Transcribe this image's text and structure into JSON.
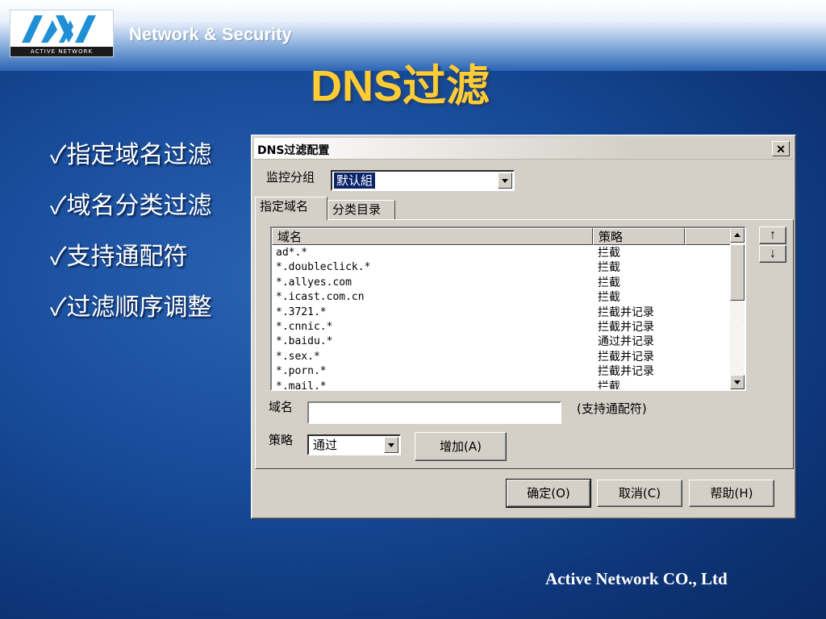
{
  "brand": {
    "logo_text": "ACTIVE NETWORK",
    "tagline": "Network & Security"
  },
  "slide": {
    "title": "DNS过滤",
    "bullets": [
      "指定域名过滤",
      "域名分类过滤",
      "支持通配符",
      "过滤顺序调整"
    ],
    "check_glyph": "✓",
    "footer": "Active Network CO., Ltd"
  },
  "dialog": {
    "title": "DNS过滤配置",
    "close_glyph": "✕",
    "group_label": "监控分组",
    "group_value": "默认組",
    "tabs": [
      {
        "label": "指定域名",
        "active": true
      },
      {
        "label": "分类目录",
        "active": false
      }
    ],
    "list": {
      "columns": [
        "域名",
        "策略"
      ],
      "rows": [
        {
          "domain": "ad*.*",
          "policy": "拦截"
        },
        {
          "domain": "*.doubleclick.*",
          "policy": "拦截"
        },
        {
          "domain": "*.allyes.com",
          "policy": "拦截"
        },
        {
          "domain": "*.icast.com.cn",
          "policy": "拦截"
        },
        {
          "domain": "*.3721.*",
          "policy": "拦截并记录"
        },
        {
          "domain": "*.cnnic.*",
          "policy": "拦截并记录"
        },
        {
          "domain": "*.baidu.*",
          "policy": "通过并记录"
        },
        {
          "domain": "*.sex.*",
          "policy": "拦截并记录"
        },
        {
          "domain": "*.porn.*",
          "policy": "拦截并记录"
        },
        {
          "domain": "*.mail.*",
          "policy": "拦截"
        }
      ]
    },
    "move_up_glyph": "↑",
    "move_down_glyph": "↓",
    "domain_label": "域名",
    "domain_value": "",
    "domain_hint": "(支持通配符)",
    "policy_label": "策略",
    "policy_value": "通过",
    "add_button": "增加(A)",
    "ok_button": "确定(O)",
    "cancel_button": "取消(C)",
    "help_button": "帮助(H)"
  },
  "colors": {
    "title_yellow": "#ffcc33",
    "background_blue": "#184d9b",
    "selection_blue": "#0a246a",
    "dialog_gray": "#d4d0c8"
  }
}
